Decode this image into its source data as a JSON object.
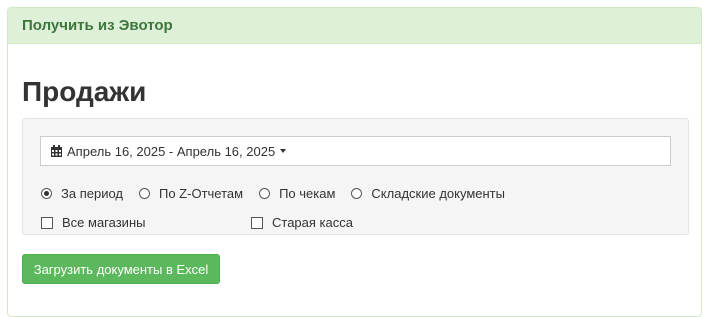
{
  "panel": {
    "heading": "Получить из Эвотор"
  },
  "page": {
    "title": "Продажи"
  },
  "filters": {
    "date_range": "Апрель 16, 2025 - Апрель 16, 2025",
    "report_types": [
      {
        "label": "За период",
        "checked": true
      },
      {
        "label": "По Z-Отчетам",
        "checked": false
      },
      {
        "label": "По чекам",
        "checked": false
      },
      {
        "label": "Складские документы",
        "checked": false
      }
    ],
    "all_stores_label": "Все магазины",
    "old_register_label": "Старая касса"
  },
  "actions": {
    "load_excel_label": "Загрузить документы в Excel"
  },
  "colors": {
    "panel_heading_bg": "#dff0d8",
    "panel_heading_text": "#3c763d",
    "button_bg": "#5cb85c"
  }
}
